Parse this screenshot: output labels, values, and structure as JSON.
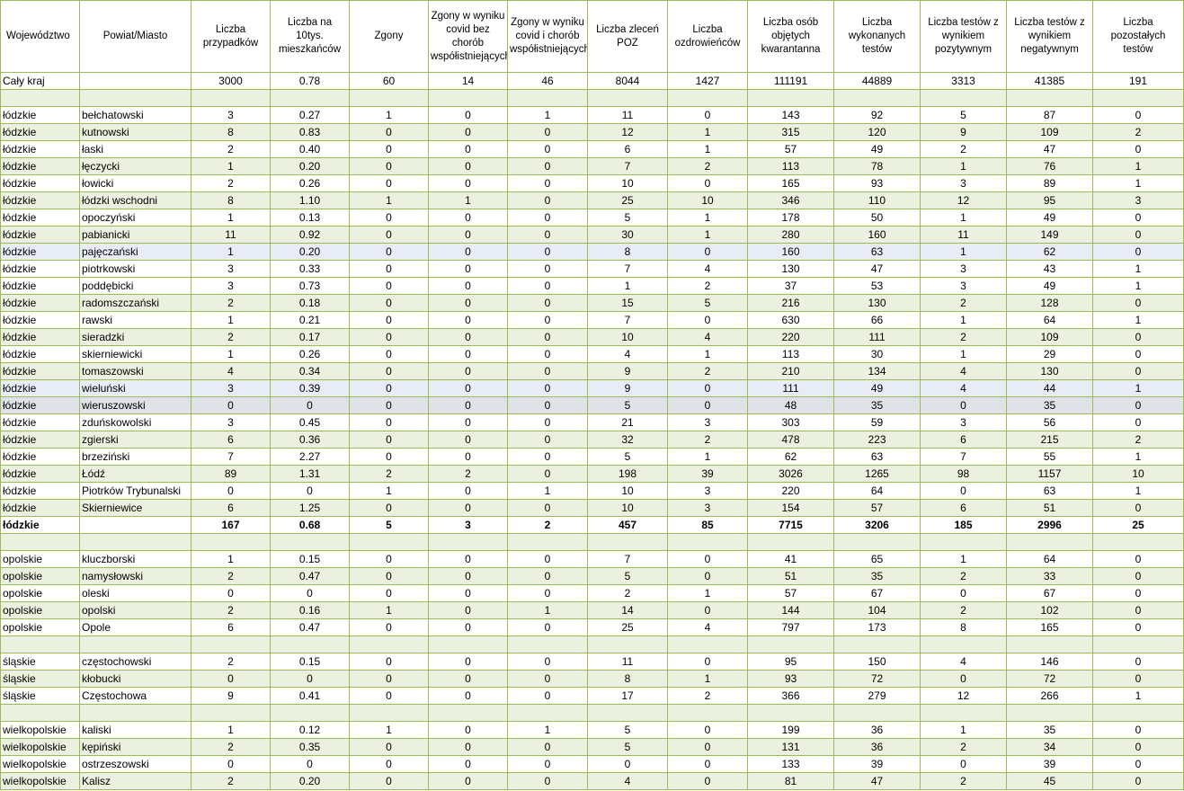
{
  "headers": [
    "Województwo",
    "Powiat/Miasto",
    "Liczba przypadków",
    "Liczba na 10tys. mieszkańców",
    "Zgony",
    "Zgony w wyniku covid bez chorób współistniejących",
    "Zgony w wyniku covid i chorób współistniejących",
    "Liczba zleceń POZ",
    "Liczba ozdrowieńców",
    "Liczba osób objętych kwarantanna",
    "Liczba wykonanych testów",
    "Liczba testów z wynikiem pozytywnym",
    "Liczba testów z wynikiem negatywnym",
    "Liczba pozostałych testów"
  ],
  "rows": [
    {
      "type": "data",
      "style": "odd",
      "cells": [
        "Cały kraj",
        "",
        "3000",
        "0.78",
        "60",
        "14",
        "46",
        "8044",
        "1427",
        "111191",
        "44889",
        "3313",
        "41385",
        "191"
      ]
    },
    {
      "type": "spacer"
    },
    {
      "type": "data",
      "style": "odd",
      "cells": [
        "łódzkie",
        "bełchatowski",
        "3",
        "0.27",
        "1",
        "0",
        "1",
        "11",
        "0",
        "143",
        "92",
        "5",
        "87",
        "0"
      ]
    },
    {
      "type": "data",
      "style": "even",
      "cells": [
        "łódzkie",
        "kutnowski",
        "8",
        "0.83",
        "0",
        "0",
        "0",
        "12",
        "1",
        "315",
        "120",
        "9",
        "109",
        "2"
      ]
    },
    {
      "type": "data",
      "style": "odd",
      "cells": [
        "łódzkie",
        "łaski",
        "2",
        "0.40",
        "0",
        "0",
        "0",
        "6",
        "1",
        "57",
        "49",
        "2",
        "47",
        "0"
      ]
    },
    {
      "type": "data",
      "style": "even",
      "cells": [
        "łódzkie",
        "łęczycki",
        "1",
        "0.20",
        "0",
        "0",
        "0",
        "7",
        "2",
        "113",
        "78",
        "1",
        "76",
        "1"
      ]
    },
    {
      "type": "data",
      "style": "odd",
      "cells": [
        "łódzkie",
        "łowicki",
        "2",
        "0.26",
        "0",
        "0",
        "0",
        "10",
        "0",
        "165",
        "93",
        "3",
        "89",
        "1"
      ]
    },
    {
      "type": "data",
      "style": "even",
      "cells": [
        "łódzkie",
        "łódzki wschodni",
        "8",
        "1.10",
        "1",
        "1",
        "0",
        "25",
        "10",
        "346",
        "110",
        "12",
        "95",
        "3"
      ]
    },
    {
      "type": "data",
      "style": "odd",
      "cells": [
        "łódzkie",
        "opoczyński",
        "1",
        "0.13",
        "0",
        "0",
        "0",
        "5",
        "1",
        "178",
        "50",
        "1",
        "49",
        "0"
      ]
    },
    {
      "type": "data",
      "style": "even",
      "cells": [
        "łódzkie",
        "pabianicki",
        "11",
        "0.92",
        "0",
        "0",
        "0",
        "30",
        "1",
        "280",
        "160",
        "11",
        "149",
        "0"
      ]
    },
    {
      "type": "data",
      "style": "hl-blue",
      "cells": [
        "łódzkie",
        "pajęczański",
        "1",
        "0.20",
        "0",
        "0",
        "0",
        "8",
        "0",
        "160",
        "63",
        "1",
        "62",
        "0"
      ]
    },
    {
      "type": "data",
      "style": "odd",
      "cells": [
        "łódzkie",
        "piotrkowski",
        "3",
        "0.33",
        "0",
        "0",
        "0",
        "7",
        "4",
        "130",
        "47",
        "3",
        "43",
        "1"
      ]
    },
    {
      "type": "data",
      "style": "odd",
      "cells": [
        "łódzkie",
        "poddębicki",
        "3",
        "0.73",
        "0",
        "0",
        "0",
        "1",
        "2",
        "37",
        "53",
        "3",
        "49",
        "1"
      ]
    },
    {
      "type": "data",
      "style": "even",
      "cells": [
        "łódzkie",
        "radomszczański",
        "2",
        "0.18",
        "0",
        "0",
        "0",
        "15",
        "5",
        "216",
        "130",
        "2",
        "128",
        "0"
      ]
    },
    {
      "type": "data",
      "style": "odd",
      "cells": [
        "łódzkie",
        "rawski",
        "1",
        "0.21",
        "0",
        "0",
        "0",
        "7",
        "0",
        "630",
        "66",
        "1",
        "64",
        "1"
      ]
    },
    {
      "type": "data",
      "style": "even",
      "cells": [
        "łódzkie",
        "sieradzki",
        "2",
        "0.17",
        "0",
        "0",
        "0",
        "10",
        "4",
        "220",
        "111",
        "2",
        "109",
        "0"
      ]
    },
    {
      "type": "data",
      "style": "odd",
      "cells": [
        "łódzkie",
        "skierniewicki",
        "1",
        "0.26",
        "0",
        "0",
        "0",
        "4",
        "1",
        "113",
        "30",
        "1",
        "29",
        "0"
      ]
    },
    {
      "type": "data",
      "style": "even",
      "cells": [
        "łódzkie",
        "tomaszowski",
        "4",
        "0.34",
        "0",
        "0",
        "0",
        "9",
        "2",
        "210",
        "134",
        "4",
        "130",
        "0"
      ]
    },
    {
      "type": "data",
      "style": "hl-blue",
      "cells": [
        "łódzkie",
        "wieluński",
        "3",
        "0.39",
        "0",
        "0",
        "0",
        "9",
        "0",
        "111",
        "49",
        "4",
        "44",
        "1"
      ]
    },
    {
      "type": "data",
      "style": "hl-gray",
      "cells": [
        "łódzkie",
        "wieruszowski",
        "0",
        "0",
        "0",
        "0",
        "0",
        "5",
        "0",
        "48",
        "35",
        "0",
        "35",
        "0"
      ]
    },
    {
      "type": "data",
      "style": "odd",
      "cells": [
        "łódzkie",
        "zduńskowolski",
        "3",
        "0.45",
        "0",
        "0",
        "0",
        "21",
        "3",
        "303",
        "59",
        "3",
        "56",
        "0"
      ]
    },
    {
      "type": "data",
      "style": "even",
      "cells": [
        "łódzkie",
        "zgierski",
        "6",
        "0.36",
        "0",
        "0",
        "0",
        "32",
        "2",
        "478",
        "223",
        "6",
        "215",
        "2"
      ]
    },
    {
      "type": "data",
      "style": "odd",
      "cells": [
        "łódzkie",
        "brzeziński",
        "7",
        "2.27",
        "0",
        "0",
        "0",
        "5",
        "1",
        "62",
        "63",
        "7",
        "55",
        "1"
      ]
    },
    {
      "type": "data",
      "style": "even",
      "cells": [
        "łódzkie",
        "Łódź",
        "89",
        "1.31",
        "2",
        "2",
        "0",
        "198",
        "39",
        "3026",
        "1265",
        "98",
        "1157",
        "10"
      ]
    },
    {
      "type": "data",
      "style": "odd",
      "cells": [
        "łódzkie",
        "Piotrków Trybunalski",
        "0",
        "0",
        "1",
        "0",
        "1",
        "10",
        "3",
        "220",
        "64",
        "0",
        "63",
        "1"
      ]
    },
    {
      "type": "data",
      "style": "even",
      "cells": [
        "łódzkie",
        "Skierniewice",
        "6",
        "1.25",
        "0",
        "0",
        "0",
        "10",
        "3",
        "154",
        "57",
        "6",
        "51",
        "0"
      ]
    },
    {
      "type": "total",
      "style": "odd",
      "cells": [
        "łódzkie",
        "",
        "167",
        "0.68",
        "5",
        "3",
        "2",
        "457",
        "85",
        "7715",
        "3206",
        "185",
        "2996",
        "25"
      ]
    },
    {
      "type": "spacer"
    },
    {
      "type": "data",
      "style": "odd",
      "cells": [
        "opolskie",
        "kluczborski",
        "1",
        "0.15",
        "0",
        "0",
        "0",
        "7",
        "0",
        "41",
        "65",
        "1",
        "64",
        "0"
      ]
    },
    {
      "type": "data",
      "style": "even",
      "cells": [
        "opolskie",
        "namysłowski",
        "2",
        "0.47",
        "0",
        "0",
        "0",
        "5",
        "0",
        "51",
        "35",
        "2",
        "33",
        "0"
      ]
    },
    {
      "type": "data",
      "style": "odd",
      "cells": [
        "opolskie",
        "oleski",
        "0",
        "0",
        "0",
        "0",
        "0",
        "2",
        "1",
        "57",
        "67",
        "0",
        "67",
        "0"
      ]
    },
    {
      "type": "data",
      "style": "even",
      "cells": [
        "opolskie",
        "opolski",
        "2",
        "0.16",
        "1",
        "0",
        "1",
        "14",
        "0",
        "144",
        "104",
        "2",
        "102",
        "0"
      ]
    },
    {
      "type": "data",
      "style": "odd",
      "cells": [
        "opolskie",
        "Opole",
        "6",
        "0.47",
        "0",
        "0",
        "0",
        "25",
        "4",
        "797",
        "173",
        "8",
        "165",
        "0"
      ]
    },
    {
      "type": "spacer"
    },
    {
      "type": "data",
      "style": "odd",
      "cells": [
        "śląskie",
        "częstochowski",
        "2",
        "0.15",
        "0",
        "0",
        "0",
        "11",
        "0",
        "95",
        "150",
        "4",
        "146",
        "0"
      ]
    },
    {
      "type": "data",
      "style": "even",
      "cells": [
        "śląskie",
        "kłobucki",
        "0",
        "0",
        "0",
        "0",
        "0",
        "8",
        "1",
        "93",
        "72",
        "0",
        "72",
        "0"
      ]
    },
    {
      "type": "data",
      "style": "odd",
      "cells": [
        "śląskie",
        "Częstochowa",
        "9",
        "0.41",
        "0",
        "0",
        "0",
        "17",
        "2",
        "366",
        "279",
        "12",
        "266",
        "1"
      ]
    },
    {
      "type": "spacer"
    },
    {
      "type": "data",
      "style": "odd",
      "cells": [
        "wielkopolskie",
        "kaliski",
        "1",
        "0.12",
        "1",
        "0",
        "1",
        "5",
        "0",
        "199",
        "36",
        "1",
        "35",
        "0"
      ]
    },
    {
      "type": "data",
      "style": "even",
      "cells": [
        "wielkopolskie",
        "kępiński",
        "2",
        "0.35",
        "0",
        "0",
        "0",
        "5",
        "0",
        "131",
        "36",
        "2",
        "34",
        "0"
      ]
    },
    {
      "type": "data",
      "style": "odd",
      "cells": [
        "wielkopolskie",
        "ostrzeszowski",
        "0",
        "0",
        "0",
        "0",
        "0",
        "0",
        "0",
        "133",
        "39",
        "0",
        "39",
        "0"
      ]
    },
    {
      "type": "data",
      "style": "even",
      "cells": [
        "wielkopolskie",
        "Kalisz",
        "2",
        "0.20",
        "0",
        "0",
        "0",
        "4",
        "0",
        "81",
        "47",
        "2",
        "45",
        "0"
      ]
    }
  ]
}
